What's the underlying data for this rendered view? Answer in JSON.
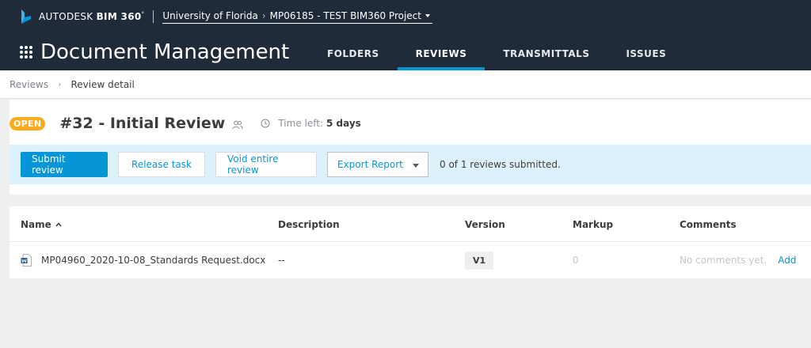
{
  "header": {
    "brand_prefix": "AUTODESK",
    "brand_product": "BIM 360",
    "brand_trademark": "°",
    "account": "University of Florida",
    "project_separator": "›",
    "project": "MP06185 - TEST BIM360 Project",
    "app_title": "Document Management",
    "tabs": [
      {
        "label": "FOLDERS",
        "active": false
      },
      {
        "label": "REVIEWS",
        "active": true
      },
      {
        "label": "TRANSMITTALS",
        "active": false
      },
      {
        "label": "ISSUES",
        "active": false
      }
    ]
  },
  "breadcrumb": {
    "parent": "Reviews",
    "separator": "›",
    "current": "Review detail"
  },
  "review": {
    "status": "OPEN",
    "title": "#32 - Initial Review",
    "time_left_label": "Time left:",
    "time_left_value": "5 days"
  },
  "actions": {
    "submit": "Submit review",
    "release": "Release task",
    "void": "Void entire review",
    "export": "Export Report",
    "submitted_count": "0 of 1 reviews submitted."
  },
  "table": {
    "columns": {
      "name": "Name",
      "description": "Description",
      "version": "Version",
      "markup": "Markup",
      "comments": "Comments"
    },
    "rows": [
      {
        "name": "MP04960_2020-10-08_Standards Request.docx",
        "description": "--",
        "version": "V1",
        "markup": "0",
        "comments": "No comments yet.",
        "add": "Add"
      }
    ]
  },
  "colors": {
    "topbar": "#1f2b38",
    "accent": "#0696d7",
    "status_open": "#fbac1e",
    "action_bar": "#ddf1fa"
  },
  "icons": {
    "logo": "bim360-logo-icon",
    "apps": "grid-icon",
    "members": "people-icon",
    "timer": "clock-icon",
    "sort": "caret-up-icon",
    "file": "word-doc-icon"
  }
}
